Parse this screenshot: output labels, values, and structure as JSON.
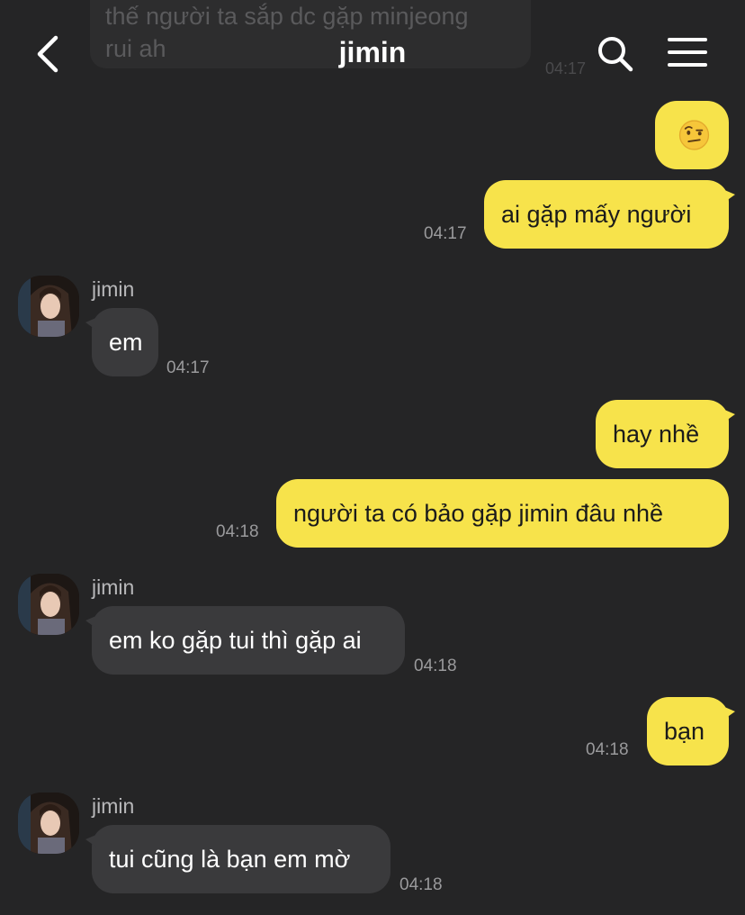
{
  "header": {
    "title": "jimin",
    "back_icon": "chevron-left-icon",
    "search_icon": "search-icon",
    "menu_icon": "hamburger-menu-icon"
  },
  "faded_message": {
    "text": "thế người ta sắp dc gặp minjeong\nrui ah",
    "time": "04:17"
  },
  "messages": [
    {
      "dir": "out",
      "text": "",
      "emoji": "face-with-raised-eyebrow",
      "time": ""
    },
    {
      "dir": "out",
      "text": "ai gặp mấy người",
      "time": "04:17"
    },
    {
      "dir": "in",
      "sender": "jimin",
      "text": "em",
      "time": "04:17"
    },
    {
      "dir": "out",
      "text": "hay nhề",
      "time": ""
    },
    {
      "dir": "out",
      "text": "người ta có bảo gặp jimin đâu nhề",
      "time": "04:18"
    },
    {
      "dir": "in",
      "sender": "jimin",
      "text": "em ko gặp tui thì gặp ai",
      "time": "04:18"
    },
    {
      "dir": "out",
      "text": "bạn",
      "time": "04:18"
    },
    {
      "dir": "in",
      "sender": "jimin",
      "text": "tui cũng là bạn em mờ",
      "time": "04:18"
    }
  ],
  "colors": {
    "background": "#252526",
    "outgoing_bubble": "#f7e34b",
    "incoming_bubble": "#3a3a3c",
    "timestamp": "#9a9a9c"
  }
}
